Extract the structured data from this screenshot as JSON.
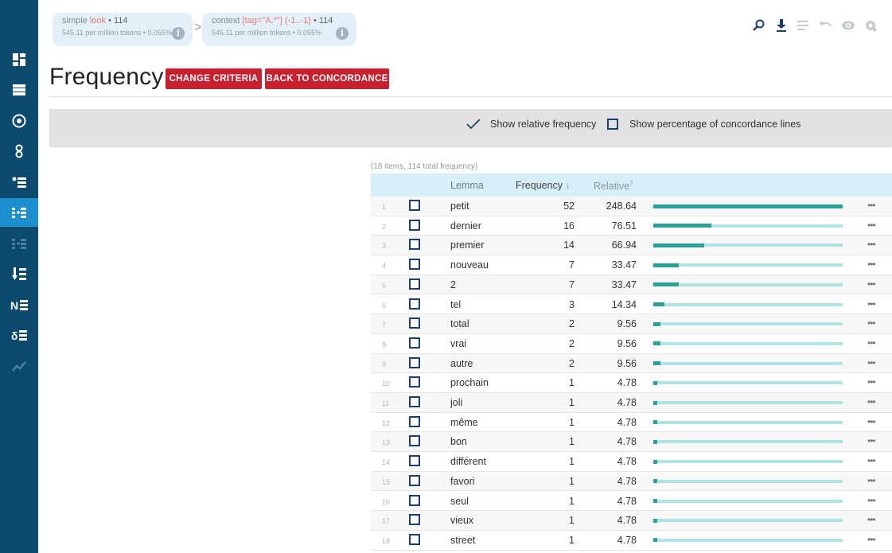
{
  "breadcrumbs": [
    {
      "prefix": "simple ",
      "highlight": "look",
      "count": " • 114",
      "detail": "545.11 per million tokens • 0.055%",
      "info_icon": "i"
    },
    {
      "prefix": "context ",
      "highlight": "[tag=\"A.*\"] (-1..-1)",
      "count": " • 114",
      "detail": "545.11 per million tokens • 0.055%",
      "info_icon": "i"
    }
  ],
  "crumb_separator": ">",
  "title": "Frequency",
  "buttons": {
    "change_criteria": "CHANGE CRITERIA",
    "back_to_concordance": "BACK TO CONCORDANCE"
  },
  "options": {
    "relative_frequency": {
      "label": "Show relative frequency",
      "checked": true
    },
    "percentage_lines": {
      "label": "Show percentage of concordance lines",
      "checked": false
    }
  },
  "table": {
    "summary": "(18 items, 114 total frequency)",
    "headers": {
      "lemma": "Lemma",
      "frequency": "Frequency",
      "sort_arrow": "↓",
      "relative": "Relative",
      "relative_hint": "?"
    },
    "more_label": "•••",
    "max_relative": 248.64,
    "rows": [
      {
        "n": "1",
        "lemma": "petit",
        "freq": "52",
        "rel": "248.64",
        "rel_value": 248.64
      },
      {
        "n": "2",
        "lemma": "dernier",
        "freq": "16",
        "rel": "76.51",
        "rel_value": 76.51
      },
      {
        "n": "3",
        "lemma": "premier",
        "freq": "14",
        "rel": "66.94",
        "rel_value": 66.94
      },
      {
        "n": "4",
        "lemma": "nouveau",
        "freq": "7",
        "rel": "33.47",
        "rel_value": 33.47
      },
      {
        "n": "5",
        "lemma": "2",
        "freq": "7",
        "rel": "33.47",
        "rel_value": 33.47
      },
      {
        "n": "6",
        "lemma": "tel",
        "freq": "3",
        "rel": "14.34",
        "rel_value": 14.34
      },
      {
        "n": "7",
        "lemma": "total",
        "freq": "2",
        "rel": "9.56",
        "rel_value": 9.56
      },
      {
        "n": "8",
        "lemma": "vrai",
        "freq": "2",
        "rel": "9.56",
        "rel_value": 9.56
      },
      {
        "n": "9",
        "lemma": "autre",
        "freq": "2",
        "rel": "9.56",
        "rel_value": 9.56
      },
      {
        "n": "10",
        "lemma": "prochain",
        "freq": "1",
        "rel": "4.78",
        "rel_value": 4.78
      },
      {
        "n": "11",
        "lemma": "joli",
        "freq": "1",
        "rel": "4.78",
        "rel_value": 4.78
      },
      {
        "n": "12",
        "lemma": "même",
        "freq": "1",
        "rel": "4.78",
        "rel_value": 4.78
      },
      {
        "n": "13",
        "lemma": "bon",
        "freq": "1",
        "rel": "4.78",
        "rel_value": 4.78
      },
      {
        "n": "14",
        "lemma": "différent",
        "freq": "1",
        "rel": "4.78",
        "rel_value": 4.78
      },
      {
        "n": "15",
        "lemma": "favori",
        "freq": "1",
        "rel": "4.78",
        "rel_value": 4.78
      },
      {
        "n": "16",
        "lemma": "seul",
        "freq": "1",
        "rel": "4.78",
        "rel_value": 4.78
      },
      {
        "n": "17",
        "lemma": "vieux",
        "freq": "1",
        "rel": "4.78",
        "rel_value": 4.78
      },
      {
        "n": "18",
        "lemma": "street",
        "freq": "1",
        "rel": "4.78",
        "rel_value": 4.78
      }
    ]
  },
  "sidebar_icons": [
    "dashboard-icon",
    "list-icon",
    "target-icon",
    "collocation-icon",
    "bullet-list-icon",
    "frequency-icon",
    "multi-frequency-icon",
    "sort-icon",
    "ngram-icon",
    "keyword-icon",
    "trends-icon"
  ],
  "toolbar_icons": [
    "search-icon",
    "download-icon",
    "view-options-icon",
    "undo-icon",
    "visibility-icon",
    "settings-icon"
  ],
  "colors": {
    "sidebar": "#0b4a6e",
    "sidebar_active": "#1c8fd0",
    "red_button": "#c8202f",
    "bar_fill": "#2aa198",
    "bar_track": "#aee4e4",
    "table_header": "#d5eef8"
  }
}
